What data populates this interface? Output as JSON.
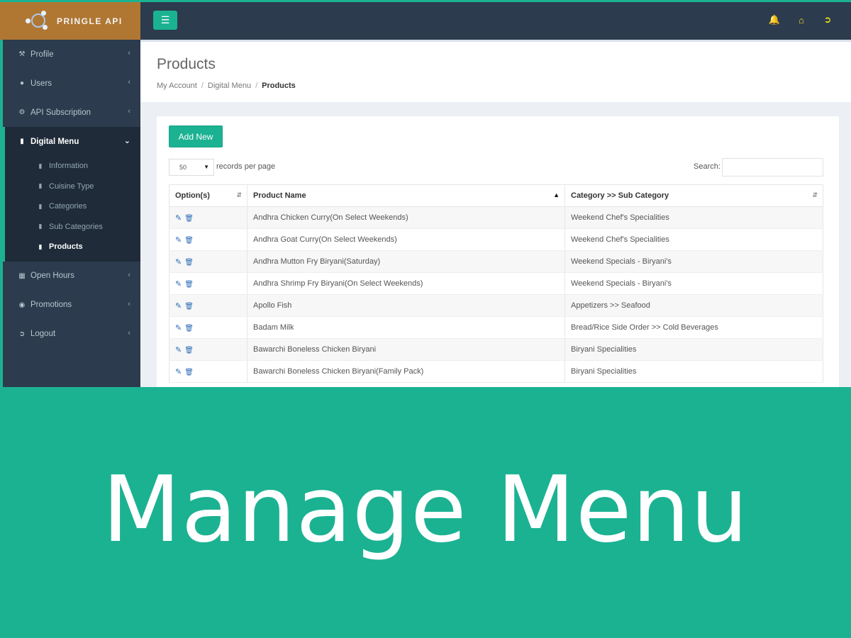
{
  "brand": {
    "name": "PRINGLE API"
  },
  "header": {
    "menu_toggle_icon": "bars-icon",
    "icons": [
      "bell-icon",
      "home-icon",
      "sign-out-icon"
    ]
  },
  "sidebar": {
    "items": [
      {
        "label": "Profile",
        "icon": "wrench-icon"
      },
      {
        "label": "Users",
        "icon": "users-icon"
      },
      {
        "label": "API Subscription",
        "icon": "cogs-icon"
      },
      {
        "label": "Digital Menu",
        "icon": "cutlery-icon"
      },
      {
        "label": "Open Hours",
        "icon": "calendar-icon"
      },
      {
        "label": "Promotions",
        "icon": "comment-icon"
      },
      {
        "label": "Logout",
        "icon": "sign-out-icon"
      }
    ],
    "sub_items": [
      {
        "label": "Information"
      },
      {
        "label": "Cuisine Type"
      },
      {
        "label": "Categories"
      },
      {
        "label": "Sub Categories"
      },
      {
        "label": "Products"
      }
    ]
  },
  "page": {
    "title": "Products",
    "breadcrumb": [
      "My Account",
      "Digital Menu",
      "Products"
    ]
  },
  "toolbar": {
    "add_new_label": "Add New",
    "page_length": "50",
    "page_length_label": "records per page",
    "search_label": "Search:",
    "search_value": ""
  },
  "table": {
    "columns": [
      "Option(s)",
      "Product Name",
      "Category >> Sub Category"
    ],
    "rows": [
      {
        "name": "Andhra Chicken Curry(On Select Weekends)",
        "category": "Weekend Chef's Specialities"
      },
      {
        "name": "Andhra Goat Curry(On Select Weekends)",
        "category": "Weekend Chef's Specialities"
      },
      {
        "name": "Andhra Mutton Fry Biryani(Saturday)",
        "category": "Weekend Specials - Biryani's"
      },
      {
        "name": "Andhra Shrimp Fry Biryani(On Select Weekends)",
        "category": "Weekend Specials - Biryani's"
      },
      {
        "name": "Apollo Fish",
        "category": "Appetizers >> Seafood"
      },
      {
        "name": "Badam Milk",
        "category": "Bread/Rice Side Order >> Cold Beverages"
      },
      {
        "name": "Bawarchi Boneless Chicken Biryani",
        "category": "Biryani Specialities"
      },
      {
        "name": "Bawarchi Boneless Chicken Biryani(Family Pack)",
        "category": "Biryani Specialities"
      }
    ]
  },
  "banner": {
    "title": "Manage Menu"
  },
  "colors": {
    "accent": "#1bb292",
    "sidebar": "#2c3b4d",
    "brand_bg": "#b07733",
    "header_icon": "#f5e31a"
  }
}
